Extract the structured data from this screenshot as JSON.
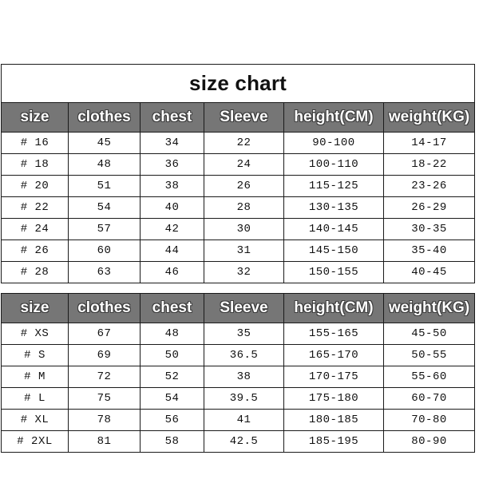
{
  "title": "size chart",
  "columns": [
    "size",
    "clothes",
    "chest",
    "Sleeve",
    "height(CM)",
    "weight(KG)"
  ],
  "colors": {
    "header_band": "#767676",
    "header_text": "#ffffff",
    "border": "#1a1a1a",
    "body_text": "#111111",
    "background": "#ffffff"
  },
  "tables": [
    {
      "has_title": true,
      "headers": [
        "size",
        "clothes",
        "chest",
        "Sleeve",
        "height(CM)",
        "weight(KG)"
      ],
      "rows": [
        [
          "# 16",
          "45",
          "34",
          "22",
          "90-100",
          "14-17"
        ],
        [
          "# 18",
          "48",
          "36",
          "24",
          "100-110",
          "18-22"
        ],
        [
          "# 20",
          "51",
          "38",
          "26",
          "115-125",
          "23-26"
        ],
        [
          "# 22",
          "54",
          "40",
          "28",
          "130-135",
          "26-29"
        ],
        [
          "# 24",
          "57",
          "42",
          "30",
          "140-145",
          "30-35"
        ],
        [
          "# 26",
          "60",
          "44",
          "31",
          "145-150",
          "35-40"
        ],
        [
          "# 28",
          "63",
          "46",
          "32",
          "150-155",
          "40-45"
        ]
      ]
    },
    {
      "has_title": false,
      "headers": [
        "size",
        "clothes",
        "chest",
        "Sleeve",
        "height(CM)",
        "weight(KG)"
      ],
      "rows": [
        [
          "# XS",
          "67",
          "48",
          "35",
          "155-165",
          "45-50"
        ],
        [
          "# S",
          "69",
          "50",
          "36.5",
          "165-170",
          "50-55"
        ],
        [
          "# M",
          "72",
          "52",
          "38",
          "170-175",
          "55-60"
        ],
        [
          "# L",
          "75",
          "54",
          "39.5",
          "175-180",
          "60-70"
        ],
        [
          "# XL",
          "78",
          "56",
          "41",
          "180-185",
          "70-80"
        ],
        [
          "# 2XL",
          "81",
          "58",
          "42.5",
          "185-195",
          "80-90"
        ]
      ]
    }
  ]
}
